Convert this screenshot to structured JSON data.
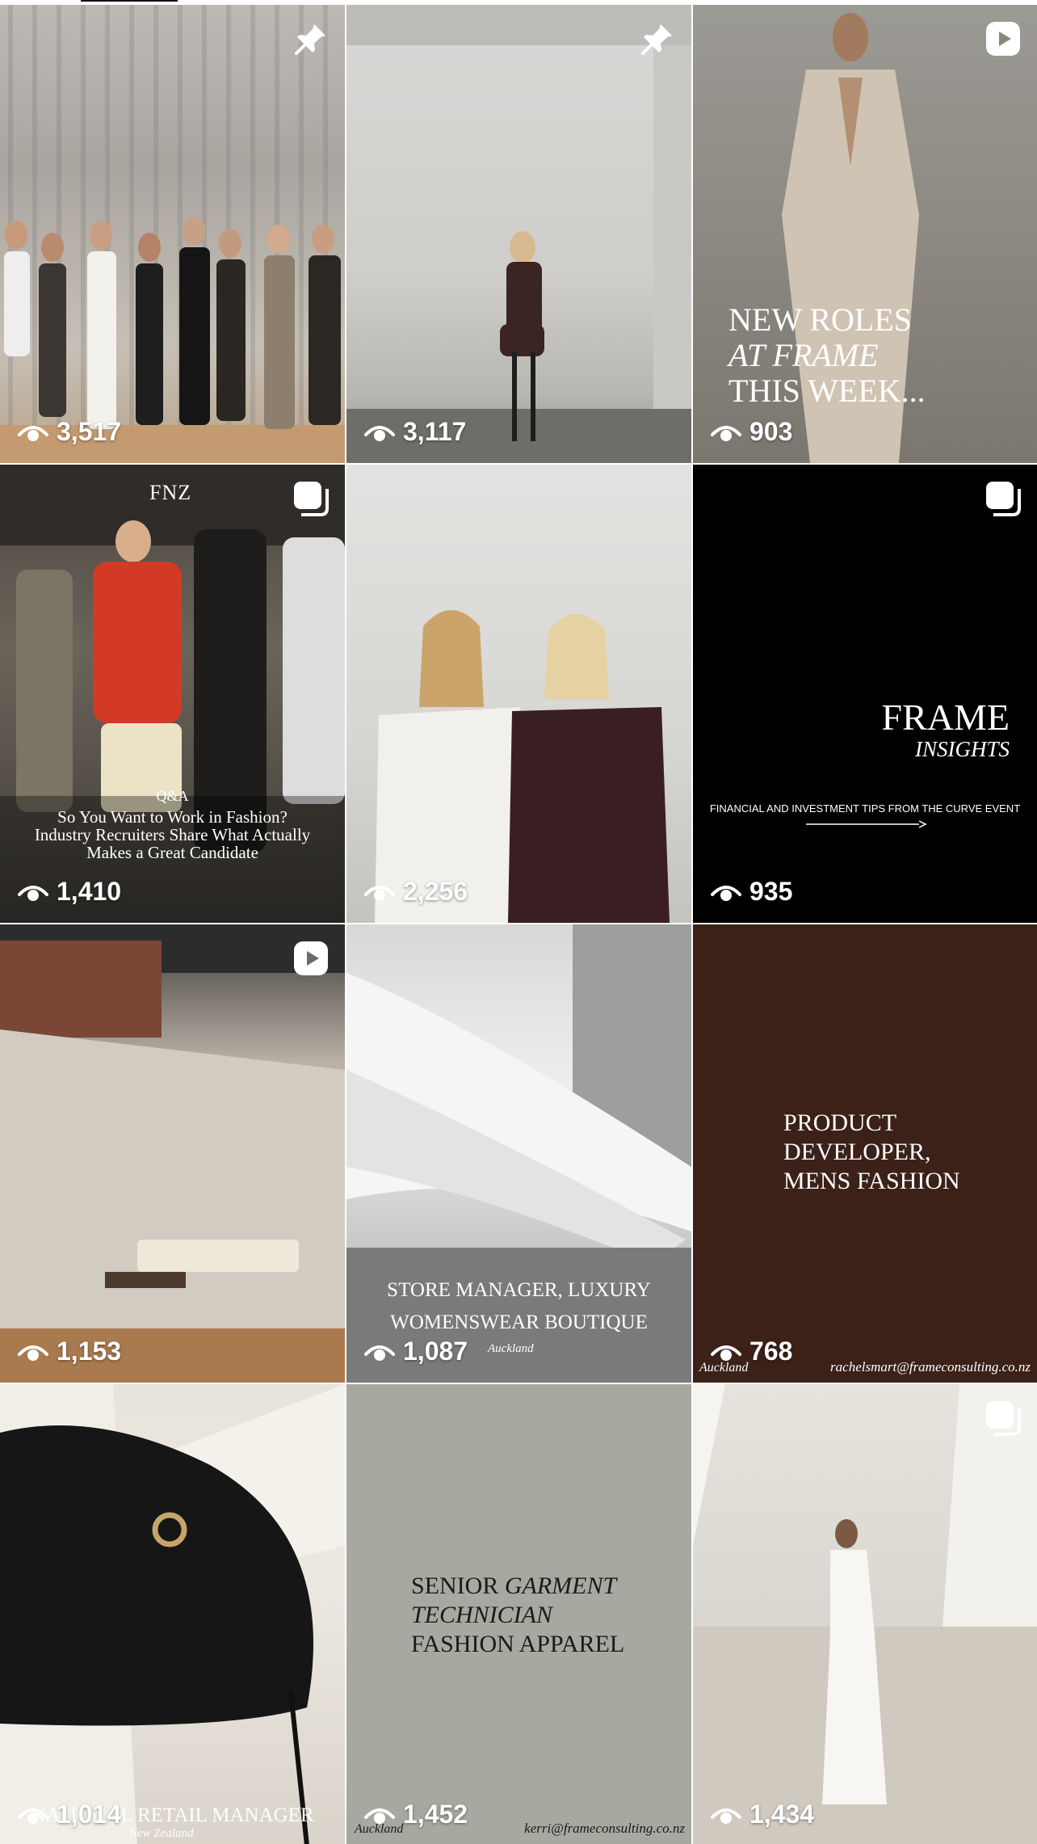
{
  "tiles": [
    {
      "views": "3,517",
      "badge": "pin-icon"
    },
    {
      "views": "3,117",
      "badge": "pin-icon"
    },
    {
      "views": "903",
      "badge": "reel-icon",
      "caption": [
        "NEW ROLES",
        "AT FRAME",
        "THIS WEEK..."
      ]
    },
    {
      "views": "1,410",
      "badge": "carousel-icon",
      "brand": "FNZ",
      "kicker": "Q&A",
      "caption": [
        "So You Want to Work in Fashion?",
        "Industry Recruiters Share What Actually",
        "Makes a Great Candidate"
      ]
    },
    {
      "views": "2,256"
    },
    {
      "views": "935",
      "badge": "carousel-icon",
      "title": "FRAME",
      "subtitle": "INSIGHTS",
      "tagline": "FINANCIAL AND INVESTMENT TIPS FROM THE CURVE EVENT"
    },
    {
      "views": "1,153",
      "badge": "reel-icon"
    },
    {
      "views": "1,087",
      "caption": [
        "STORE MANAGER, LUXURY",
        "WOMENSWEAR BOUTIQUE"
      ],
      "location": "Auckland"
    },
    {
      "views": "768",
      "caption": [
        "PRODUCT",
        "DEVELOPER,",
        "MENS FASHION"
      ],
      "location": "Auckland",
      "email": "rachelsmart@frameconsulting.co.nz"
    },
    {
      "views": "1,014",
      "caption": [
        "NATIONAL RETAIL MANAGER"
      ],
      "location": "New Zealand"
    },
    {
      "views": "1,452",
      "caption": [
        "SENIOR",
        "GARMENT",
        "TECHNICIAN",
        "FASHION APPAREL"
      ],
      "location": "Auckland",
      "email": "kerri@frameconsulting.co.nz"
    },
    {
      "views": "1,434",
      "badge": "carousel-icon"
    }
  ],
  "colors": {
    "overlay_text": "#ffffff",
    "brown_tile": "#3c2119",
    "sage_tile": "#a7a89f",
    "dark_tile": "#000000"
  }
}
